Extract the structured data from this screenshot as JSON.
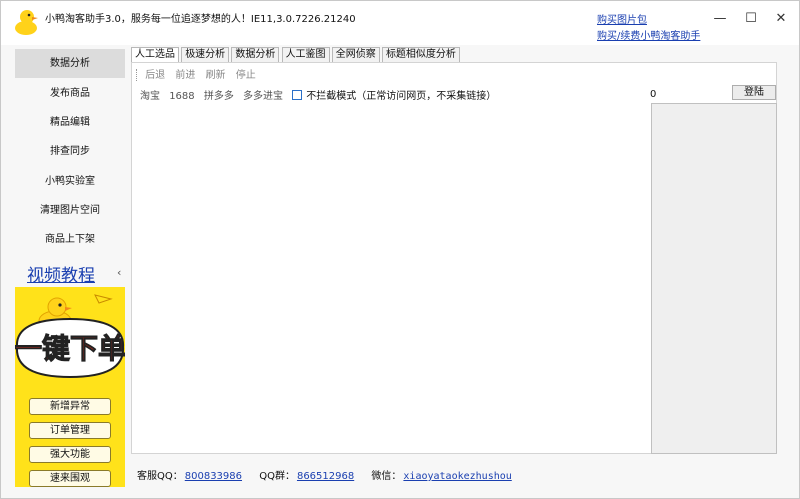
{
  "window": {
    "title": "小鸭淘客助手3.0，服务每一位追逐梦想的人！IE11,3.0.7226.21240",
    "links": {
      "buy_pack": "购买图片包",
      "buy_renew": "购买/续费小鸭淘客助手"
    },
    "controls": {
      "minimize": "—",
      "maximize": "☐",
      "close": "✕"
    }
  },
  "sidebar": {
    "items": [
      {
        "label": "数据分析",
        "active": true
      },
      {
        "label": "发布商品"
      },
      {
        "label": "精品编辑"
      },
      {
        "label": "排查同步"
      },
      {
        "label": "小鸭实验室"
      },
      {
        "label": "清理图片空间"
      },
      {
        "label": "商品上下架"
      }
    ],
    "video_tutorial": "视频教程",
    "collapse": "‹"
  },
  "promo": {
    "banner_text": "一键下单",
    "buttons": [
      "新增异常",
      "订单管理",
      "强大功能",
      "速来围观"
    ]
  },
  "tabs": [
    {
      "label": "人工选品",
      "active": true
    },
    {
      "label": "极速分析"
    },
    {
      "label": "数据分析"
    },
    {
      "label": "人工鉴图"
    },
    {
      "label": "全网侦察"
    },
    {
      "label": "标题相似度分析"
    }
  ],
  "toolbar": {
    "back": "后退",
    "forward": "前进",
    "refresh": "刷新",
    "stop": "停止"
  },
  "sources": [
    "淘宝",
    "1688",
    "拼多多",
    "多多进宝"
  ],
  "no_intercept_label": "不拦截模式（正常访问网页，不采集链接）",
  "count": "0",
  "login_label": "登陆",
  "footer": {
    "qq_label": "客服QQ：",
    "qq_value": "800833986",
    "group_label": "QQ群：",
    "group_value": "866512968",
    "wechat_label": "微信：",
    "wechat_value": "xiaoyataokezhushou"
  },
  "colors": {
    "link": "#1a3fb0",
    "promo_bg": "#ffe21a",
    "banner_red": "#e0301e",
    "duck_yellow": "#ffd21a"
  }
}
